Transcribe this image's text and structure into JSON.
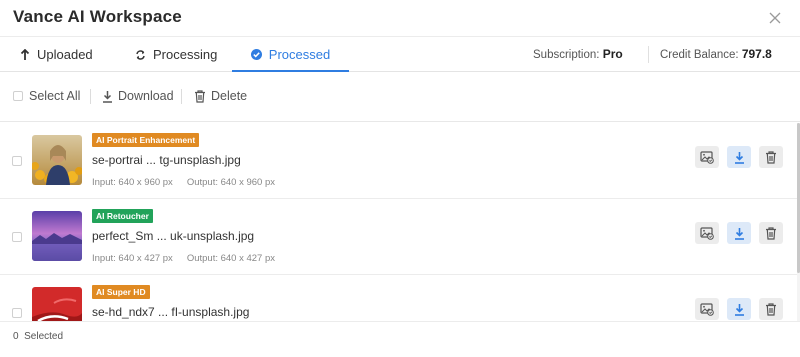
{
  "app": {
    "title": "Vance AI Workspace"
  },
  "tabs": [
    {
      "label": "Uploaded",
      "icon": "arrow-up-icon"
    },
    {
      "label": "Processing",
      "icon": "refresh-icon"
    },
    {
      "label": "Processed",
      "icon": "check-circle-icon",
      "active": true
    }
  ],
  "account": {
    "subscription_label": "Subscription:",
    "subscription_value": "Pro",
    "credit_label": "Credit Balance:",
    "credit_value": "797.8"
  },
  "toolbar": {
    "select_all": "Select All",
    "download": "Download",
    "delete": "Delete"
  },
  "files": [
    {
      "badge": "AI Portrait Enhancement",
      "badge_color": "#e08a22",
      "name": "se-portrai ... tg-unsplash.jpg",
      "input": "Input: 640 x 960 px",
      "output": "Output: 640 x 960 px"
    },
    {
      "badge": "AI Retoucher",
      "badge_color": "#22a35a",
      "name": "perfect_Sm ... uk-unsplash.jpg",
      "input": "Input: 640 x 427 px",
      "output": "Output: 640 x 427 px"
    },
    {
      "badge": "AI Super HD",
      "badge_color": "#e08a22",
      "name": "se-hd_ndx7 ... fI-unsplash.jpg",
      "input": "",
      "output": ""
    }
  ],
  "footer": {
    "selected_count": "0",
    "selected_label": "Selected"
  },
  "colors": {
    "accent": "#2f7de1",
    "text": "#333333",
    "muted": "#888888"
  }
}
